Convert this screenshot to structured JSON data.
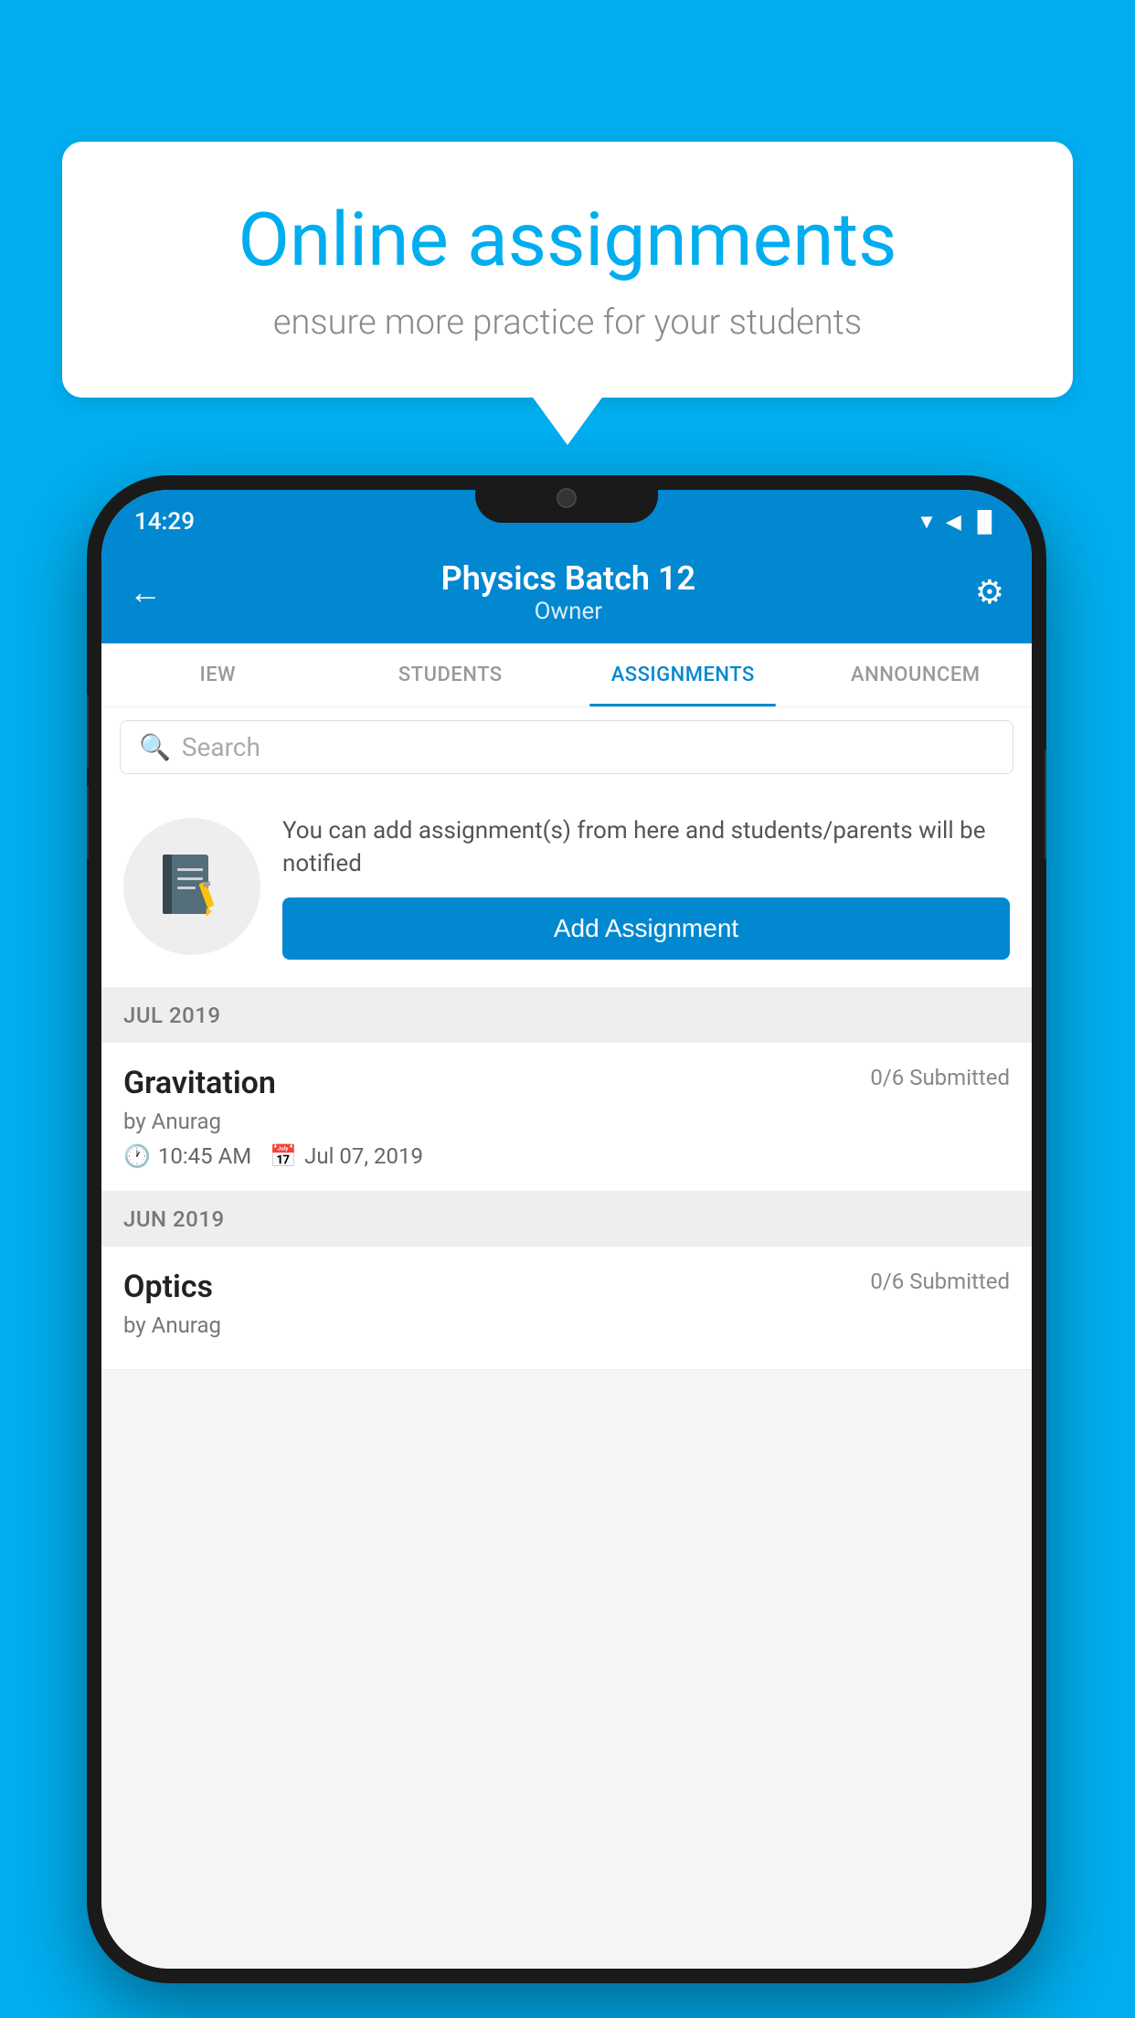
{
  "background_color": "#00AEEF",
  "speech_bubble": {
    "title": "Online assignments",
    "subtitle": "ensure more practice for your students"
  },
  "phone": {
    "status_bar": {
      "time": "14:29",
      "wifi": "▲",
      "signal": "▲",
      "battery": "▐"
    },
    "header": {
      "title": "Physics Batch 12",
      "subtitle": "Owner",
      "back_label": "←",
      "settings_label": "⚙"
    },
    "tabs": [
      {
        "label": "IEW",
        "active": false
      },
      {
        "label": "STUDENTS",
        "active": false
      },
      {
        "label": "ASSIGNMENTS",
        "active": true
      },
      {
        "label": "ANNOUNCEM",
        "active": false
      }
    ],
    "search": {
      "placeholder": "Search"
    },
    "info_card": {
      "description": "You can add assignment(s) from here and students/parents will be notified",
      "add_button_label": "Add Assignment"
    },
    "sections": [
      {
        "header": "JUL 2019",
        "assignments": [
          {
            "name": "Gravitation",
            "status": "0/6 Submitted",
            "author": "by Anurag",
            "time": "10:45 AM",
            "date": "Jul 07, 2019"
          }
        ]
      },
      {
        "header": "JUN 2019",
        "assignments": [
          {
            "name": "Optics",
            "status": "0/6 Submitted",
            "author": "by Anurag",
            "time": "",
            "date": ""
          }
        ]
      }
    ]
  }
}
